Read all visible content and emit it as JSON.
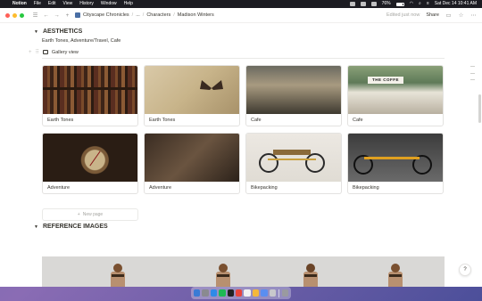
{
  "menubar": {
    "app_name": "Notion",
    "menus": [
      "File",
      "Edit",
      "View",
      "History",
      "Window",
      "Help"
    ],
    "battery": "76%",
    "datetime": "Sat Dec 14  10:41 AM"
  },
  "titlebar": {
    "breadcrumbs": [
      "Cityscape Chronicles",
      "...",
      "Characters",
      "Madison Winters"
    ],
    "edited": "Edited just now",
    "share_label": "Share"
  },
  "aesthetics": {
    "heading": "AESTHETICS",
    "tags": "Earth Tones, Adventure/Travel, Cafe",
    "view_label": "Gallery view",
    "cards": [
      {
        "label": "Earth Tones"
      },
      {
        "label": "Earth Tones"
      },
      {
        "label": "Cafe",
        "sign": "THE COFFE"
      },
      {
        "label": "Cafe"
      },
      {
        "label": "Adventure"
      },
      {
        "label": "Adventure"
      },
      {
        "label": "Bikepacking"
      },
      {
        "label": "Bikepacking"
      }
    ],
    "new_page_label": "New page"
  },
  "references": {
    "heading": "REFERENCE IMAGES"
  },
  "colors": {
    "accent_red": "#ff5f57",
    "accent_yellow": "#febc2e",
    "accent_green": "#28c840",
    "text": "#37352f"
  }
}
